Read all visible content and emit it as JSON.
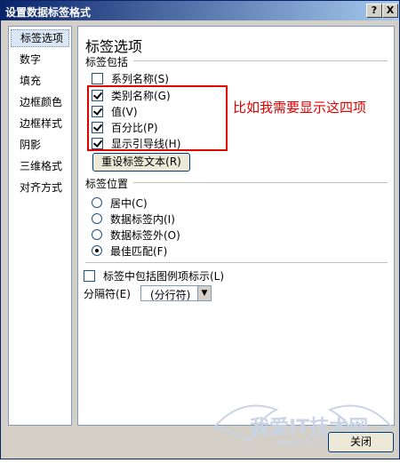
{
  "window": {
    "title": "设置数据标签格式",
    "help_btn": "?",
    "close_btn": "X"
  },
  "sidebar": {
    "items": [
      {
        "label": "标签选项",
        "selected": true
      },
      {
        "label": "数字"
      },
      {
        "label": "填充"
      },
      {
        "label": "边框颜色"
      },
      {
        "label": "边框样式"
      },
      {
        "label": "阴影"
      },
      {
        "label": "三维格式"
      },
      {
        "label": "对齐方式"
      }
    ]
  },
  "panel": {
    "title": "标签选项",
    "contains_label": "标签包括",
    "checkboxes": [
      {
        "label": "系列名称(S)",
        "checked": false
      },
      {
        "label": "类别名称(G)",
        "checked": true
      },
      {
        "label": "值(V)",
        "checked": true
      },
      {
        "label": "百分比(P)",
        "checked": true
      },
      {
        "label": "显示引导线(H)",
        "checked": true
      }
    ],
    "reset_button": "重设标签文本(R)",
    "position_label": "标签位置",
    "radios": [
      {
        "label": "居中(C)",
        "checked": false
      },
      {
        "label": "数据标签内(I)",
        "checked": false
      },
      {
        "label": "数据标签外(O)",
        "checked": false
      },
      {
        "label": "最佳匹配(F)",
        "checked": true
      }
    ],
    "legend_key_label": "标签中包括图例项标示(L)",
    "legend_key_checked": false,
    "separator_label": "分隔符(E)",
    "separator_value": "(分行符)"
  },
  "annotation": "比如我需要显示这四项",
  "close_button": "关闭",
  "watermark": {
    "text": "我爱IT技术网",
    "url": "www.52ij.com"
  },
  "colors": {
    "annotation": "#e00000",
    "titlebar": "#0a246a"
  }
}
